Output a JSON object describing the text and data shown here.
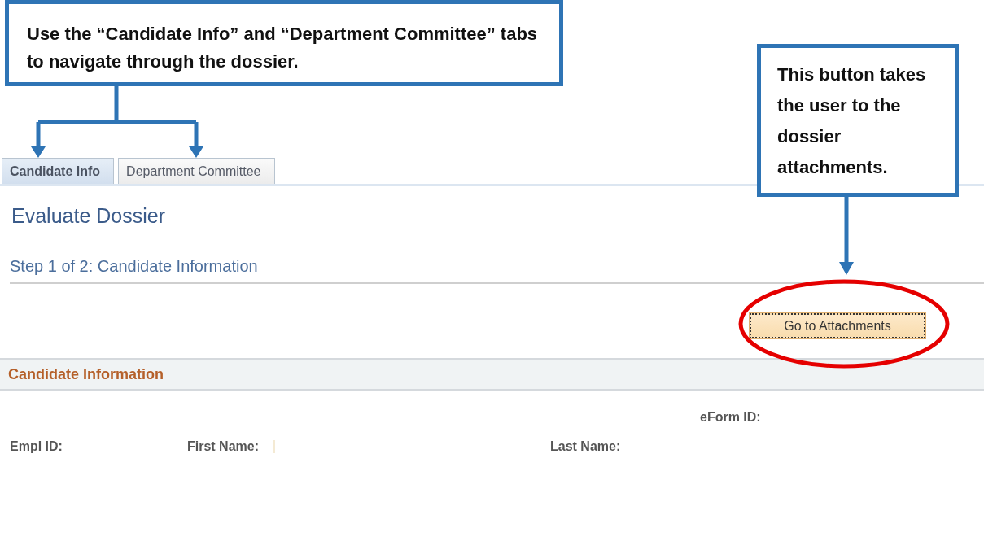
{
  "callouts": [
    {
      "text": "Use the “Candidate Info” and “Department Committee” tabs to navigate through the dossier."
    },
    {
      "text": "This button takes the user to the dossier attachments."
    }
  ],
  "tabs": [
    {
      "label": "Candidate Info",
      "selected": true
    },
    {
      "label": "Department Committee",
      "selected": false
    }
  ],
  "page_title": "Evaluate Dossier",
  "step": "Step 1 of 2: Candidate Information",
  "button": "Go to Attachments",
  "section": {
    "title": "Candidate Information",
    "fields": [
      {
        "label": "eForm ID:"
      },
      {
        "label": "Empl ID:"
      },
      {
        "label": "First Name:"
      },
      {
        "label": "Last Name:"
      }
    ]
  }
}
